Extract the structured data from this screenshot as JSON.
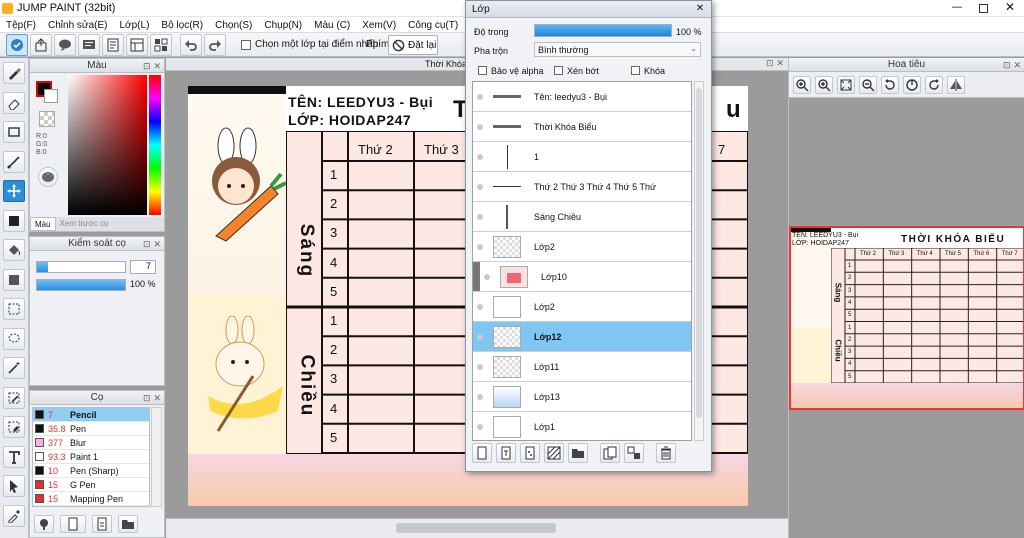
{
  "window": {
    "title": "JUMP PAINT (32bit)"
  },
  "menu": [
    "Tệp(F)",
    "Chỉnh sửa(E)",
    "Lớp(L)",
    "Bộ lọc(R)",
    "Chọn(S)",
    "Chụp(N)",
    "Màu (C)",
    "Xem(V)",
    "Công cụ(T)",
    "Cửa sổ(W)"
  ],
  "toolbar": {
    "snap_label": "Chọn một lớp tại điểm nhấp",
    "key_label": "Phím",
    "reset_label": "Đặt lại"
  },
  "color_panel": {
    "title": "Màu",
    "r": "R:0",
    "g": "G:0",
    "b": "B:0",
    "tab_color": "Màu",
    "tab_preview": "Xem trước cọ"
  },
  "brush_ctrl": {
    "title": "Kiểm soát cọ",
    "size": "7",
    "opacity": "100 %",
    "opacity_value": 100
  },
  "brush_panel": {
    "title": "Cọ",
    "items": [
      {
        "size": "7",
        "name": "Pencil",
        "color": "#111111",
        "selected": true
      },
      {
        "size": "35.8",
        "name": "Pen",
        "color": "#111111",
        "selected": false
      },
      {
        "size": "377",
        "name": "Blur",
        "color": "#ffb0e8",
        "selected": false
      },
      {
        "size": "93.3",
        "name": "Paint 1",
        "color": "#ffffff",
        "selected": false
      },
      {
        "size": "10",
        "name": "Pen (Sharp)",
        "color": "#111111",
        "selected": false
      },
      {
        "size": "15",
        "name": "G Pen",
        "color": "#e03030",
        "selected": false
      },
      {
        "size": "15",
        "name": "Mapping Pen",
        "color": "#e03030",
        "selected": false
      }
    ]
  },
  "document": {
    "tab": "Thời Khóa Biểu Cute.mdp"
  },
  "canvas": {
    "name_line": "TÊN: LEEDYU3 - Bụi",
    "class_line": "LỚP: HOIDAP247",
    "day_header": "Thứ 2",
    "day_header2": "Thứ 3",
    "title_partial_left": "T",
    "title_partial_right": "u",
    "day_partial": "7",
    "morning": "Sáng",
    "afternoon": "Chiều",
    "rows": [
      "1",
      "2",
      "3",
      "4",
      "5"
    ]
  },
  "layer_panel": {
    "title": "Lớp",
    "opacity_label": "Độ trong",
    "opacity": "100 %",
    "opacity_value": 100,
    "blend_label": "Pha trộn",
    "blend_value": "Bình thường",
    "protect_alpha": "Bảo vệ alpha",
    "clip": "Xén bớt",
    "lock": "Khóa",
    "layers": [
      {
        "name": "Tên: leedyu3 - Bụi",
        "thumb": "text",
        "selected": false,
        "indent": false,
        "bold": false
      },
      {
        "name": "Thời Khóa Biểu",
        "thumb": "text",
        "selected": false,
        "indent": false,
        "bold": false
      },
      {
        "name": "1",
        "thumb": "vline",
        "selected": false,
        "indent": false,
        "bold": false
      },
      {
        "name": "Thứ 2   Thứ 3   Thứ 4   Thứ 5   Thứ",
        "thumb": "hline",
        "selected": false,
        "indent": false,
        "bold": false
      },
      {
        "name": "Sáng     Chiều",
        "thumb": "vline2",
        "selected": false,
        "indent": false,
        "bold": false
      },
      {
        "name": "Lớp2",
        "thumb": "check",
        "selected": false,
        "indent": false,
        "bold": false
      },
      {
        "name": "Lớp10",
        "thumb": "pic",
        "selected": false,
        "indent": true,
        "bold": false
      },
      {
        "name": "Lớp2",
        "thumb": "blank",
        "selected": false,
        "indent": false,
        "bold": false
      },
      {
        "name": "Lớp12",
        "thumb": "check",
        "selected": true,
        "indent": false,
        "bold": true
      },
      {
        "name": "Lớp11",
        "thumb": "check",
        "selected": false,
        "indent": false,
        "bold": false
      },
      {
        "name": "Lớp13",
        "thumb": "blue",
        "selected": false,
        "indent": false,
        "bold": false
      },
      {
        "name": "Lớp1",
        "thumb": "blank",
        "selected": false,
        "indent": false,
        "bold": false
      }
    ]
  },
  "navigator": {
    "title": "Hoa tiêu"
  },
  "preview": {
    "name_line": "TÊN: LEEDYU3 - Bụi",
    "class_line": "LỚP: HOIDAP247",
    "title": "THỜI KHÓA BIỂU",
    "days": [
      "Thứ 2",
      "Thứ 3",
      "Thứ 4",
      "Thứ 5",
      "Thứ 6",
      "Thứ 7"
    ],
    "morning": "Sáng",
    "afternoon": "Chiều",
    "rows": [
      "1",
      "2",
      "3",
      "4",
      "5"
    ]
  },
  "colors": {
    "accent": "#0a84d8",
    "selected_row": "#7fc6f2",
    "brush_selected": "#8fcdf3"
  }
}
